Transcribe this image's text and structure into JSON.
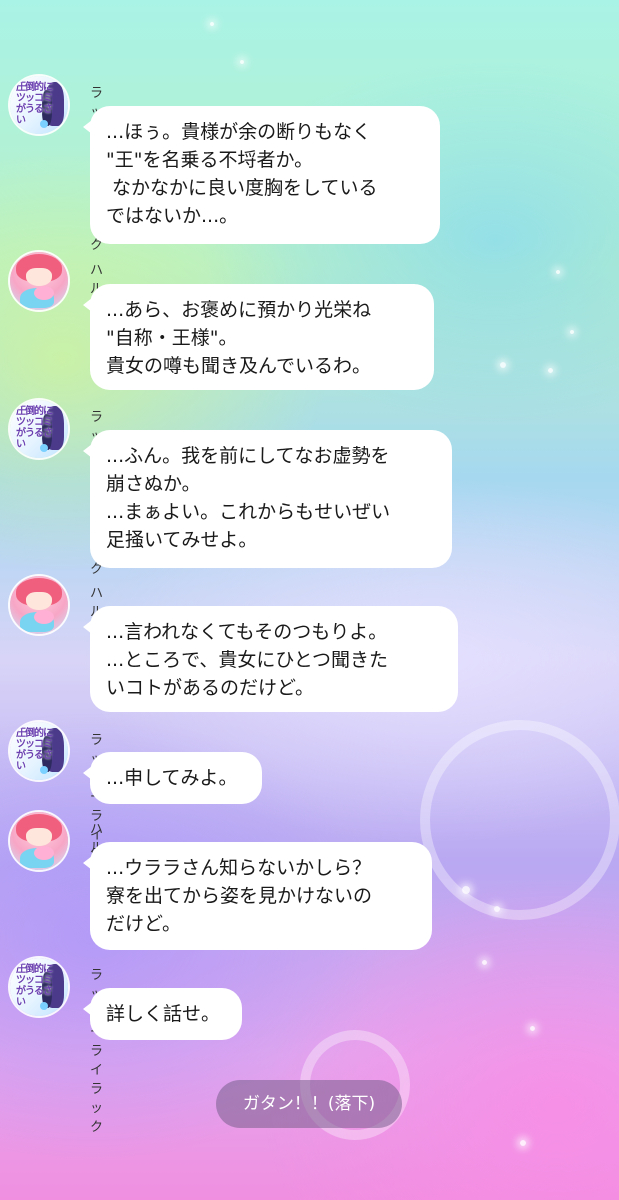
{
  "messages": [
    {
      "sender": "ラッキーライラック",
      "avatar": "lucky-lilac",
      "avatar_text": "圧倒的にツッコミがうるさい",
      "text": "...ほぅ。貴様が余の断りもなく\n\"王\"を名乗る不埒者か。\n なかなかに良い度胸をしている\nではないか...。"
    },
    {
      "sender": "ハルウララ",
      "avatar": "haru-urara",
      "text": "...あら、お褒めに預かり光栄ね\n\"自称・王様\"。\n貴女の噂も聞き及んでいるわ。"
    },
    {
      "sender": "ラッキーライラック",
      "avatar": "lucky-lilac",
      "avatar_text": "圧倒的にツッコミがうるさい",
      "text": "...ふん。我を前にしてなお虚勢を\n崩さぬか。\n...まぁよい。これからもせいぜい\n足掻いてみせよ。"
    },
    {
      "sender": "ハルウララ",
      "avatar": "haru-urara",
      "text": "...言われなくてもそのつもりよ。\n...ところで、貴女にひとつ聞きた\nいコトがあるのだけど。"
    },
    {
      "sender": "ラッキーライラック",
      "avatar": "lucky-lilac",
      "avatar_text": "圧倒的にツッコミがうるさい",
      "text": "...申してみよ。"
    },
    {
      "sender": "ハルウララ",
      "avatar": "haru-urara",
      "text": "...ウララさん知らないかしら？\n寮を出てから姿を見かけないの\nだけど。"
    },
    {
      "sender": "ラッキーライラック",
      "avatar": "lucky-lilac",
      "avatar_text": "圧倒的にツッコミがうるさい",
      "text": "詳しく話せ。"
    }
  ],
  "system_message": "ガタン！！(落下)"
}
